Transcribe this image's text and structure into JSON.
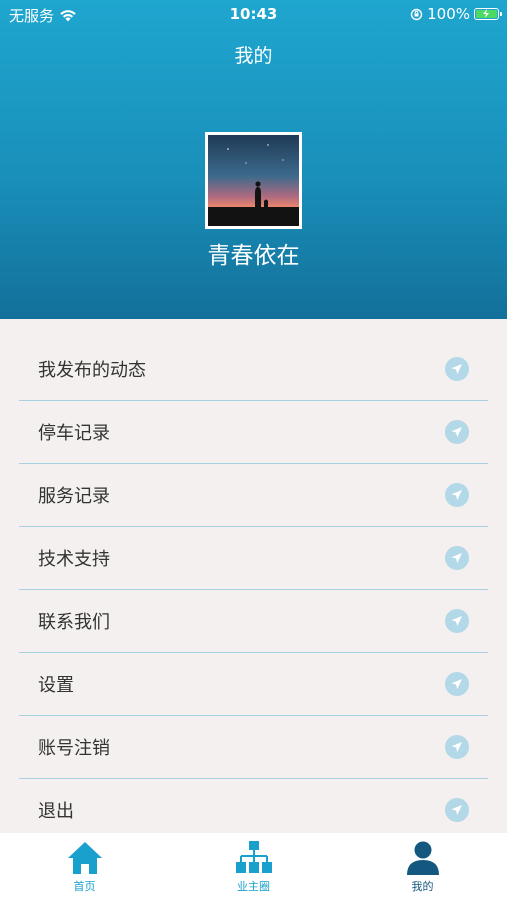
{
  "status_bar": {
    "carrier": "无服务",
    "time": "10:43",
    "battery": "100%"
  },
  "header": {
    "title": "我的",
    "username": "青春依在"
  },
  "menu": {
    "items": [
      {
        "label": "我发布的动态",
        "icon": "send-icon"
      },
      {
        "label": "停车记录",
        "icon": "send-icon"
      },
      {
        "label": "服务记录",
        "icon": "send-icon"
      },
      {
        "label": "技术支持",
        "icon": "send-icon"
      },
      {
        "label": "联系我们",
        "icon": "send-icon"
      },
      {
        "label": "设置",
        "icon": "send-icon"
      },
      {
        "label": "账号注销",
        "icon": "send-icon"
      },
      {
        "label": "退出",
        "icon": "send-icon"
      }
    ]
  },
  "tabbar": {
    "items": [
      {
        "label": "首页",
        "icon": "home-icon"
      },
      {
        "label": "业主圈",
        "icon": "network-icon"
      },
      {
        "label": "我的",
        "icon": "user-icon"
      }
    ]
  },
  "colors": {
    "accent": "#1aa0cc",
    "header_dark": "#13709a",
    "divider": "#a8cfe0",
    "menu_icon": "#b3d8e7",
    "background": "#f3f0ef"
  }
}
